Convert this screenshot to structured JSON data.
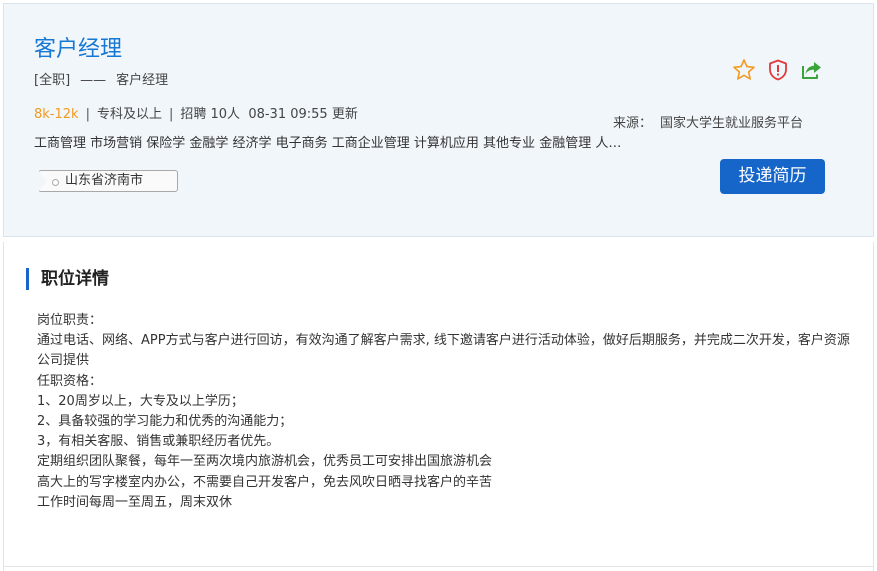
{
  "job": {
    "title": "客户经理",
    "type": "[全职]",
    "dash": "——",
    "category": "客户经理",
    "salary": "8k-12k",
    "education": "专科及以上",
    "recruit": "招聘 10人",
    "updated": "08-31 09:55 更新",
    "separator": "|",
    "majors": "工商管理 市场营销 保险学 金融学 经济学 电子商务 工商企业管理 计算机应用 其他专业 金融管理 人…",
    "location": "山东省济南市"
  },
  "source": {
    "label": "来源：",
    "value": "国家大学生就业服务平台"
  },
  "actions": {
    "apply_label": "投递简历",
    "icons": [
      "star-icon",
      "shield-report-icon",
      "share-icon"
    ]
  },
  "colors": {
    "accent": "#1566c8",
    "title": "#1678d4",
    "salary": "#f39a1e",
    "star": "#f39a1e",
    "shield": "#e03a3a",
    "share": "#3aa43a"
  },
  "detail": {
    "section_title": "职位详情",
    "lines": [
      "岗位职责：",
      "通过电话、网络、APP方式与客户进行回访，有效沟通了解客户需求, 线下邀请客户进行活动体验，做好后期服务，并完成二次开发，客户资源公司提供",
      "任职资格：",
      "1、20周岁以上，大专及以上学历；",
      "2、具备较强的学习能力和优秀的沟通能力；",
      "3，有相关客服、销售或兼职经历者优先。",
      "定期组织团队聚餐，每年一至两次境内旅游机会，优秀员工可安排出国旅游机会",
      "高大上的写字楼室内办公，不需要自己开发客户，免去风吹日晒寻找客户的辛苦",
      "工作时间每周一至周五，周末双休"
    ]
  }
}
